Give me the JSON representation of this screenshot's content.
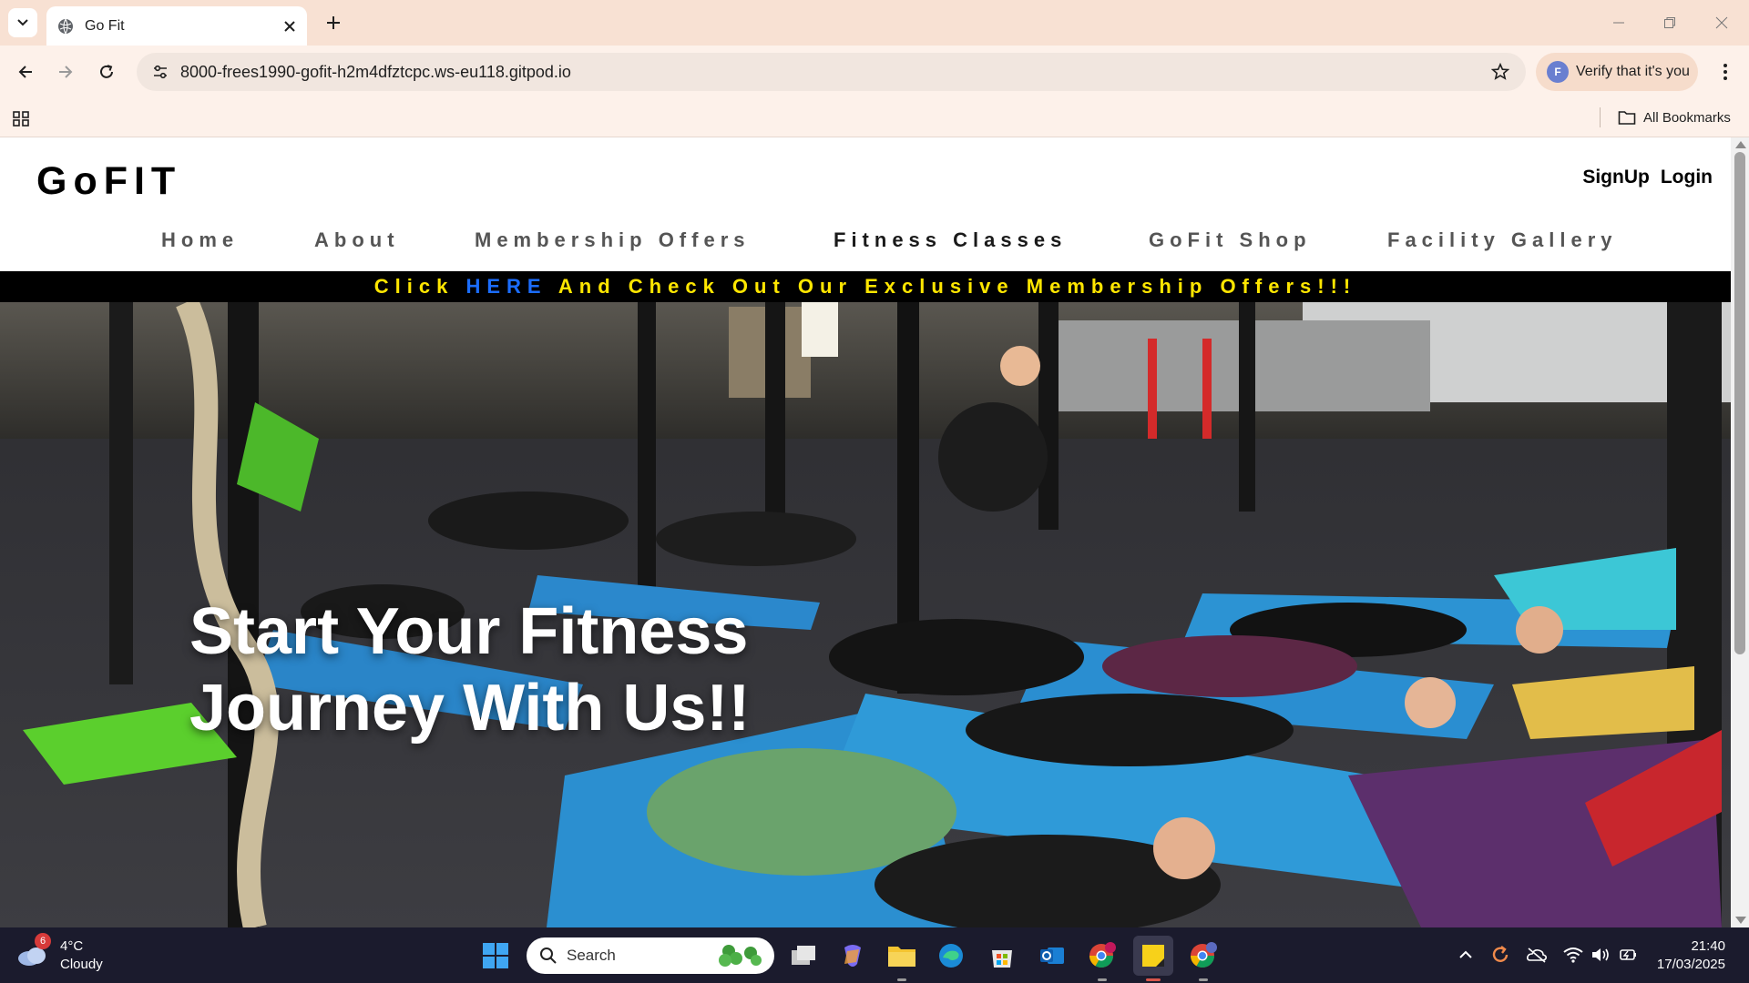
{
  "browser": {
    "tab_title": "Go Fit",
    "url": "8000-frees1990-gofit-h2m4dfztcpc.ws-eu118.gitpod.io",
    "verify_label": "Verify that it's you",
    "profile_initial": "F",
    "all_bookmarks_label": "All Bookmarks"
  },
  "site": {
    "brand": "GoFIT",
    "auth": {
      "signup": "SignUp",
      "login": "Login"
    },
    "nav": [
      "Home",
      "About",
      "Membership Offers",
      "Fitness Classes",
      "GoFit Shop",
      "Facility Gallery"
    ],
    "active_nav": "Fitness Classes",
    "promo": {
      "before": "Click ",
      "link": "HERE",
      "after": " And Check Out Our Exclusive Membership Offers!!!"
    },
    "hero": {
      "line1": "Start Your Fitness",
      "line2": "Journey With Us!!"
    }
  },
  "colors": {
    "promo_text": "#ffe600",
    "promo_link": "#1b6dff",
    "tabbar_bg": "#f8e1d3",
    "taskbar_bg": "#1b1b2d"
  },
  "taskbar": {
    "weather_badge": "6",
    "temperature": "4°C",
    "condition": "Cloudy",
    "search_placeholder": "Search",
    "time": "21:40",
    "date": "17/03/2025",
    "icons": [
      "windows-start-icon",
      "search-icon",
      "task-view-icon",
      "copilot-icon",
      "file-explorer-icon",
      "edge-icon",
      "microsoft-store-icon",
      "outlook-icon",
      "chrome-profile-icon",
      "sticky-notes-icon",
      "chrome-icon"
    ]
  }
}
